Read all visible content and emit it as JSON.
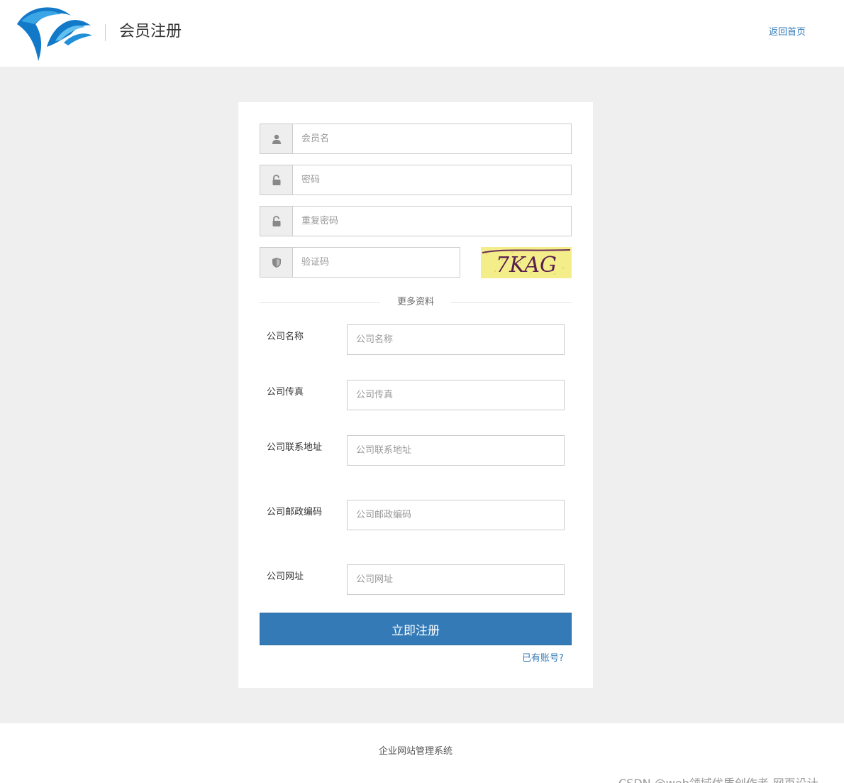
{
  "header": {
    "title": "会员注册",
    "home_link": "返回首页"
  },
  "form": {
    "username_placeholder": "会员名",
    "password_placeholder": "密码",
    "repeat_password_placeholder": "重复密码",
    "captcha_placeholder": "验证码",
    "captcha_text": "7KAG",
    "more_info_label": "更多资料",
    "fields": [
      {
        "label": "公司名称",
        "placeholder": "公司名称"
      },
      {
        "label": "公司传真",
        "placeholder": "公司传真"
      },
      {
        "label": "公司联系地址",
        "placeholder": "公司联系地址"
      },
      {
        "label": "公司邮政编码",
        "placeholder": "公司邮政编码"
      },
      {
        "label": "公司网址",
        "placeholder": "公司网址"
      }
    ],
    "submit_label": "立即注册",
    "login_link": "已有账号?"
  },
  "footer": {
    "text": "企业网站管理系统",
    "watermark": "CSDN @web领域优质创作者-网页设计"
  },
  "colors": {
    "primary": "#337ab7",
    "page_background": "#efefef",
    "captcha_background": "#f4ee8a"
  }
}
